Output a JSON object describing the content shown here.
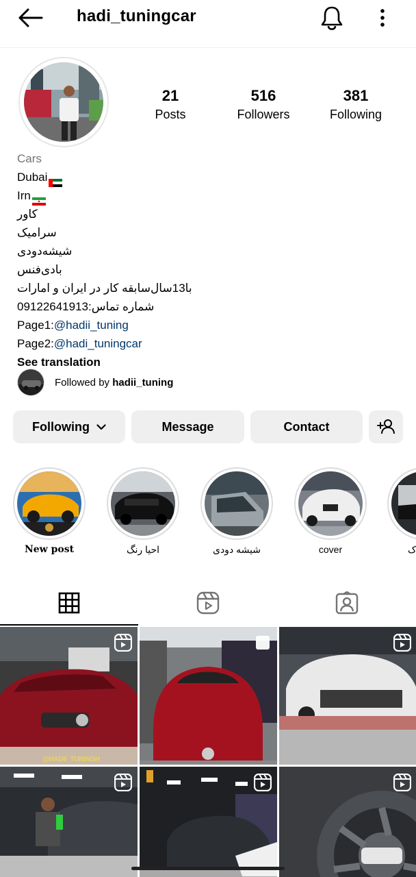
{
  "header": {
    "username": "hadi_tuningcar"
  },
  "stats": {
    "posts_count": "21",
    "posts_label": "Posts",
    "followers_count": "516",
    "followers_label": "Followers",
    "following_count": "381",
    "following_label": "Following"
  },
  "bio": {
    "category": "Cars",
    "lines": [
      "Dubai",
      "Irn",
      "کاور",
      "سرامیک",
      "شیشه‌دودی",
      "بادی‌فنس",
      "با13سال‌سابقه کار در ایران و امارات",
      "شماره تماس:09122641913"
    ],
    "page1_prefix": "Page1:",
    "page1_link": "@hadii_tuning",
    "page2_prefix": "Page2:",
    "page2_link": "@hadi_tuningcar",
    "see_translation": "See translation"
  },
  "followed_by": {
    "prefix": "Followed by ",
    "user": "hadii_tuning"
  },
  "actions": {
    "following": "Following",
    "message": "Message",
    "contact": "Contact"
  },
  "highlights": [
    {
      "label": "New post"
    },
    {
      "label": "احیا رنگ"
    },
    {
      "label": "شیشه دودی"
    },
    {
      "label": "cover"
    },
    {
      "label": "ک"
    }
  ],
  "tabs": [
    "grid-tab",
    "reels-tab",
    "tagged-tab"
  ],
  "grid_badges": [
    "reel",
    "multi",
    "reel",
    "reel",
    "reel",
    "reel"
  ],
  "grid_caption": "@HADII_TUNINGH",
  "colors": {
    "link": "#00376b",
    "button_bg": "#efefef",
    "secondary_text": "#737373"
  }
}
